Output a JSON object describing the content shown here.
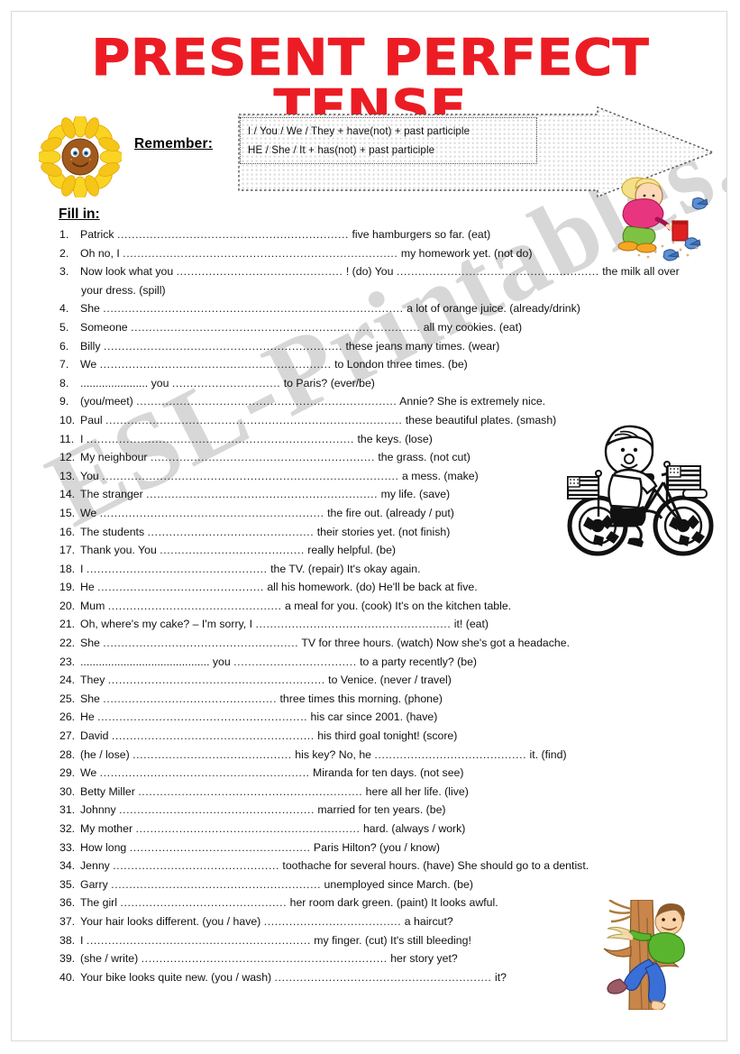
{
  "title": "PRESENT PERFECT TENSE",
  "title_color": "#ec1c24",
  "remember": {
    "label": "Remember:",
    "rules": [
      "I / You / We / They + have(not) + past participle",
      "HE / She / It + has(not) + past participle"
    ]
  },
  "fill_in_label": "Fill in:",
  "watermark": "ESL-Printables.com",
  "blank_short": "............................",
  "blank_med": "..........................................",
  "exercises": [
    {
      "num": "1.",
      "parts": [
        "Patrick  ",
        "................................................................",
        " five hamburgers so far. (eat)"
      ]
    },
    {
      "num": "2.",
      "parts": [
        "Oh no, I ",
        "............................................................................",
        " my homework yet. (not do)"
      ]
    },
    {
      "num": "3.",
      "parts": [
        "Now look what you ",
        "..............................................",
        " ! (do) You ",
        "........................................................",
        " the milk all over"
      ],
      "cont": "your dress. (spill)"
    },
    {
      "num": "4.",
      "parts": [
        "She ",
        "...................................................................................",
        " a lot of orange juice. (already/drink)"
      ]
    },
    {
      "num": "5.",
      "parts": [
        "Someone ",
        "................................................................................",
        " all my cookies. (eat)"
      ]
    },
    {
      "num": "6.",
      "parts": [
        "Billy ",
        "..................................................................",
        " these jeans many times. (wear)"
      ]
    },
    {
      "num": "7.",
      "parts": [
        "We ",
        "................................................................",
        " to London three times. (be)"
      ]
    },
    {
      "num": "8.",
      "parts": [
        "...................... you  ",
        "..............................",
        " to Paris? (ever/be)"
      ]
    },
    {
      "num": "9.",
      "parts": [
        "(you/meet) ",
        "........................................................................",
        " Annie? She is extremely nice."
      ]
    },
    {
      "num": "10.",
      "parts": [
        "Paul ",
        "..................................................................................",
        " these beautiful plates. (smash)"
      ]
    },
    {
      "num": "11.",
      "parts": [
        "I ",
        "..........................................................................",
        " the keys. (lose)"
      ]
    },
    {
      "num": "12.",
      "parts": [
        "My neighbour ",
        "..............................................................",
        " the grass. (not cut)"
      ]
    },
    {
      "num": "13.",
      "parts": [
        "You ",
        "..................................................................................",
        " a mess. (make)"
      ]
    },
    {
      "num": "14.",
      "parts": [
        "The stranger ",
        "................................................................",
        " my life. (save)"
      ]
    },
    {
      "num": "15.",
      "parts": [
        "We ",
        "..............................................................",
        " the fire out. (already / put)"
      ]
    },
    {
      "num": "16.",
      "parts": [
        "The students ",
        "..............................................",
        " their stories yet. (not finish)"
      ]
    },
    {
      "num": "17.",
      "parts": [
        "Thank you. You ",
        "........................................",
        " really helpful. (be)"
      ]
    },
    {
      "num": "18.",
      "parts": [
        "I ",
        "..................................................",
        " the TV. (repair) It's okay again."
      ]
    },
    {
      "num": "19.",
      "parts": [
        "He ",
        "..............................................",
        " all his homework. (do) He'll be back at five."
      ]
    },
    {
      "num": "20.",
      "parts": [
        "Mum ",
        "................................................",
        " a meal for you. (cook) It's on the kitchen table."
      ]
    },
    {
      "num": "21.",
      "parts": [
        " Oh, where's my cake? – I'm sorry, I ",
        "......................................................",
        " it! (eat)"
      ]
    },
    {
      "num": "22.",
      "parts": [
        "She ",
        "......................................................",
        " TV for three hours. (watch) Now she's got a headache."
      ]
    },
    {
      "num": "23.",
      "parts": [
        ".......................................... you ",
        "..................................",
        " to a party recently? (be)"
      ]
    },
    {
      "num": "24.",
      "parts": [
        " They ",
        "............................................................",
        " to Venice. (never / travel)"
      ]
    },
    {
      "num": "25.",
      "parts": [
        "She ",
        "................................................",
        " three times this morning. (phone)"
      ]
    },
    {
      "num": "26.",
      "parts": [
        "He ",
        "..........................................................",
        " his car since 2001. (have)"
      ]
    },
    {
      "num": "27.",
      "parts": [
        "David ",
        "........................................................",
        " his third goal tonight! (score)"
      ]
    },
    {
      "num": "28.",
      "parts": [
        "(he / lose) ",
        "............................................",
        " his key? No, he ",
        "..........................................",
        " it. (find)"
      ]
    },
    {
      "num": "29.",
      "parts": [
        "We ",
        "..........................................................",
        " Miranda for ten days. (not see)"
      ]
    },
    {
      "num": "30.",
      "parts": [
        "Betty Miller ",
        "..............................................................",
        " here all her life. (live)"
      ]
    },
    {
      "num": "31.",
      "parts": [
        "Johnny ",
        "......................................................",
        " married for ten years. (be)"
      ]
    },
    {
      "num": "32.",
      "parts": [
        " My mother ",
        "..............................................................",
        " hard. (always / work)"
      ]
    },
    {
      "num": "33.",
      "parts": [
        "How long ",
        "..................................................",
        " Paris Hilton? (you / know)"
      ]
    },
    {
      "num": "34.",
      "parts": [
        "Jenny ",
        "..............................................",
        " toothache for several hours. (have) She should go to a dentist."
      ]
    },
    {
      "num": "35.",
      "parts": [
        "Garry ",
        "..........................................................",
        " unemployed since March. (be)"
      ]
    },
    {
      "num": "36.",
      "parts": [
        "The girl ",
        "..............................................",
        " her room dark green. (paint) It looks awful."
      ]
    },
    {
      "num": "37.",
      "parts": [
        "Your hair looks different. (you / have) ",
        "......................................",
        " a haircut?"
      ]
    },
    {
      "num": "38.",
      "parts": [
        "I ",
        "..............................................................",
        " my finger. (cut) It's still bleeding!"
      ]
    },
    {
      "num": "39.",
      "parts": [
        "(she / write) ",
        "....................................................................",
        " her story yet?"
      ]
    },
    {
      "num": "40.",
      "parts": [
        "Your bike looks quite new. (you / wash) ",
        "............................................................",
        " it?"
      ]
    }
  ],
  "clipart": {
    "flower": "smiling-sunflower",
    "girl": "girl-feeding-birds",
    "bike": "boy-riding-bike-with-flags",
    "tree": "boy-climbing-tree"
  }
}
